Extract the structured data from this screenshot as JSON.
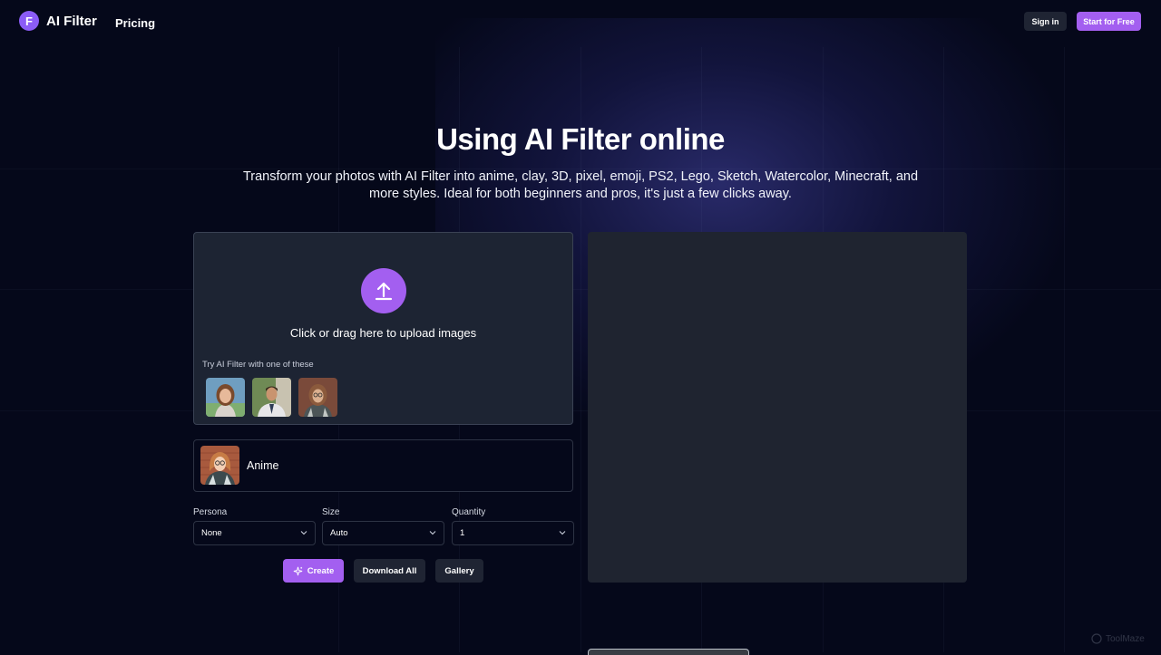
{
  "header": {
    "brand": "AI Filter",
    "logo_letter": "F",
    "nav": {
      "pricing": "Pricing"
    },
    "sign_in": "Sign in",
    "start_free": "Start for Free"
  },
  "hero": {
    "title": "Using AI Filter online",
    "subtitle": "Transform your photos with AI Filter into anime, clay, 3D, pixel, emoji, PS2, Lego, Sketch, Watercolor, Minecraft, and more styles. Ideal for both beginners and pros, it's just a few clicks away."
  },
  "upload": {
    "icon": "upload-icon",
    "text": "Click or drag here to upload images",
    "try_label": "Try AI Filter with one of these",
    "samples": [
      "sample-woman-portrait",
      "sample-man-in-suit",
      "sample-woman-glasses"
    ]
  },
  "style": {
    "label": "Anime",
    "thumb": "anime-style-thumbnail"
  },
  "options": {
    "persona": {
      "label": "Persona",
      "value": "None"
    },
    "size": {
      "label": "Size",
      "value": "Auto"
    },
    "quantity": {
      "label": "Quantity",
      "value": "1"
    }
  },
  "actions": {
    "create": "Create",
    "download_all": "Download All",
    "gallery": "Gallery"
  },
  "watermark": "ToolMaze",
  "colors": {
    "background": "#05081a",
    "accent": "#a35ff0",
    "panel": "#1d2433",
    "secondary_button": "#1f2433"
  }
}
